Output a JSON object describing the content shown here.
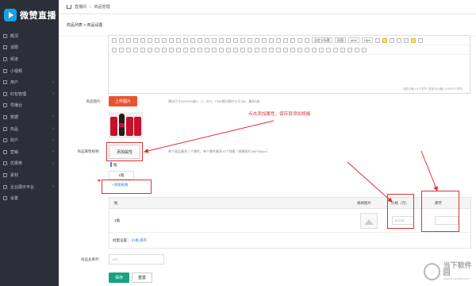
{
  "app": {
    "logo_text": "微赞直播"
  },
  "sidebar": {
    "items": [
      {
        "label": "概况",
        "arrow": ""
      },
      {
        "label": "话题",
        "arrow": ""
      },
      {
        "label": "频道",
        "arrow": ""
      },
      {
        "label": "小视频",
        "arrow": ""
      },
      {
        "label": "用户",
        "arrow": "‹"
      },
      {
        "label": "红包管理",
        "arrow": "‹"
      },
      {
        "label": "导播台",
        "arrow": ""
      },
      {
        "label": "数据",
        "arrow": "‹"
      },
      {
        "label": "商品",
        "arrow": "‹"
      },
      {
        "label": "财户",
        "arrow": "‹"
      },
      {
        "label": "营销",
        "arrow": "‹"
      },
      {
        "label": "优惠券",
        "arrow": "‹"
      },
      {
        "label": "素材",
        "arrow": ""
      },
      {
        "label": "企业展示平台",
        "arrow": "‹"
      },
      {
        "label": "设置",
        "arrow": ""
      }
    ]
  },
  "topbar": {
    "crumb_1": "直播间",
    "sep": "›",
    "crumb_2": "商品管理"
  },
  "tabbar": {
    "text": "商品列表 » 商品设置"
  },
  "editor": {
    "font_family": "arial",
    "font_size": "16px",
    "paragraph": "段落",
    "format": "自定义标题",
    "count_text": "当前已输入0个字符, 您还可以输入10000个字符。"
  },
  "form": {
    "image_label": "商品图片：",
    "upload_button": "上传图片",
    "image_hint": "建议尺寸420*420或1：1，JPG、PNG格式图片小于2M，最多5张",
    "attr_label": "商品属性规格：",
    "add_attr_button": "添加属性",
    "attr_hint": "单个商品最多三个属性，单个属性最多10个规格（规格图片360*360px）",
    "annotation": "点击添加属性，保存就添加规格",
    "attr_name": "瓶",
    "attr_value": "1瓶",
    "add_spec_link": "+添加规格",
    "table": {
      "headers": [
        "瓶",
        "规格图片",
        "价格（元）",
        "库存"
      ],
      "row": {
        "spec": "1瓶",
        "price_placeholder": "¥ 0.00"
      },
      "batch_label": "批量设置：",
      "batch_price": "价格",
      "batch_stock": "库存"
    },
    "total_stock_label": "商品总库存：",
    "total_stock_placeholder": "900",
    "save_button": "保存",
    "reset_button": "重置"
  },
  "watermark": {
    "title": "当下软件园",
    "subtitle": "www.downxia.com"
  },
  "colors": {
    "sidebar_bg": "#2b2f3a",
    "accent_red": "#e03030",
    "upload_orange": "#e8542f",
    "save_green": "#17a37f",
    "link_blue": "#2f80ed"
  }
}
